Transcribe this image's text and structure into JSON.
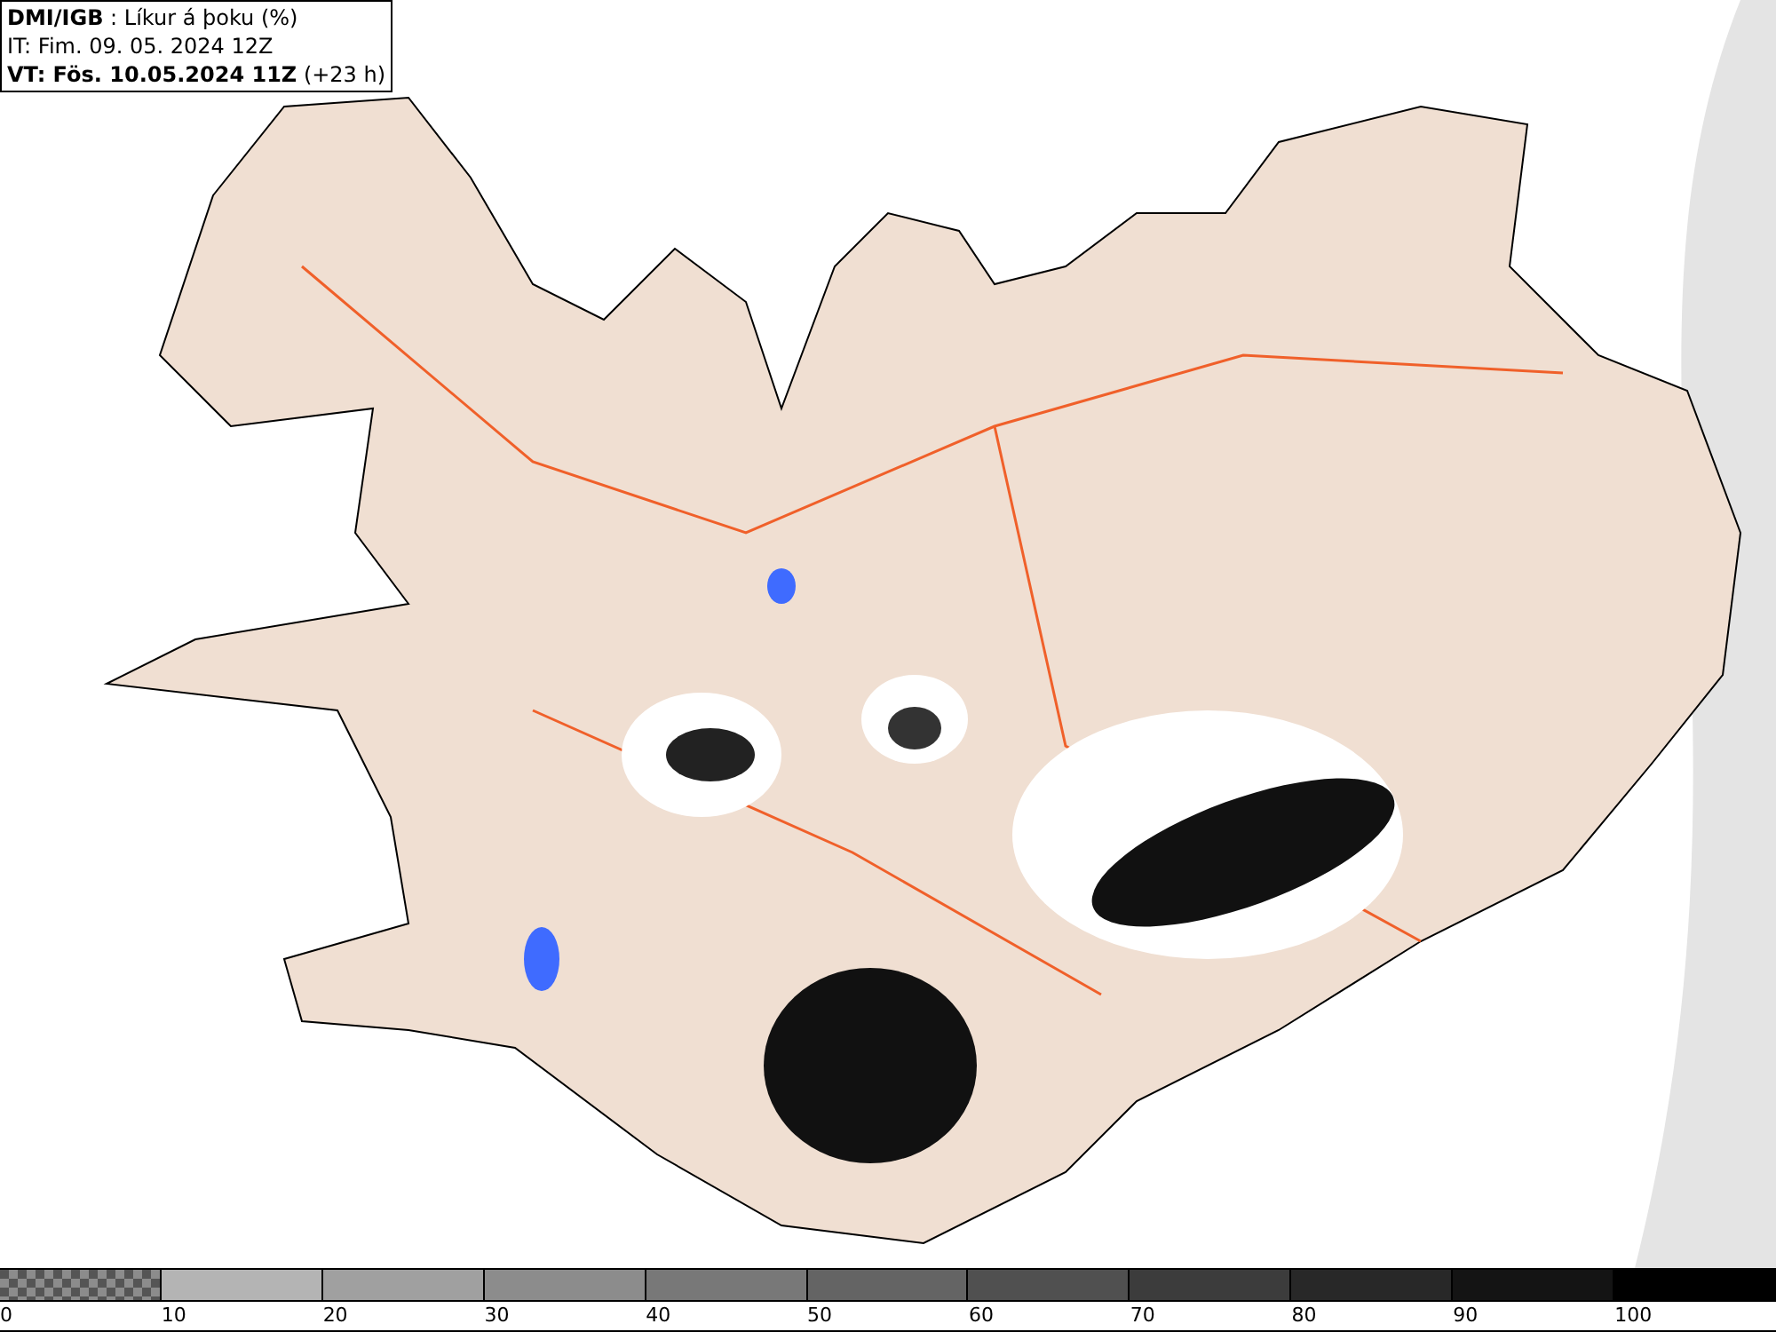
{
  "header": {
    "lines": [
      "**DMI/IGB** : Líkur á þoku (%)",
      "IT: Fim. 09. 05. 2024 12Z",
      "**VT: Fös. 10.05.2024 11Z** (+23 h)"
    ]
  },
  "legend": {
    "segments": [
      {
        "kind": "checker"
      },
      {
        "kind": "solid",
        "color": "#b4b4b4"
      },
      {
        "kind": "solid",
        "color": "#a0a0a0"
      },
      {
        "kind": "solid",
        "color": "#8c8c8c"
      },
      {
        "kind": "solid",
        "color": "#787878"
      },
      {
        "kind": "solid",
        "color": "#646464"
      },
      {
        "kind": "solid",
        "color": "#505050"
      },
      {
        "kind": "solid",
        "color": "#3c3c3c"
      },
      {
        "kind": "solid",
        "color": "#282828"
      },
      {
        "kind": "solid",
        "color": "#141414"
      },
      {
        "kind": "solid",
        "color": "#000000"
      }
    ],
    "labels": [
      "0",
      "10",
      "20",
      "30",
      "40",
      "50",
      "60",
      "70",
      "80",
      "90",
      "100"
    ]
  }
}
